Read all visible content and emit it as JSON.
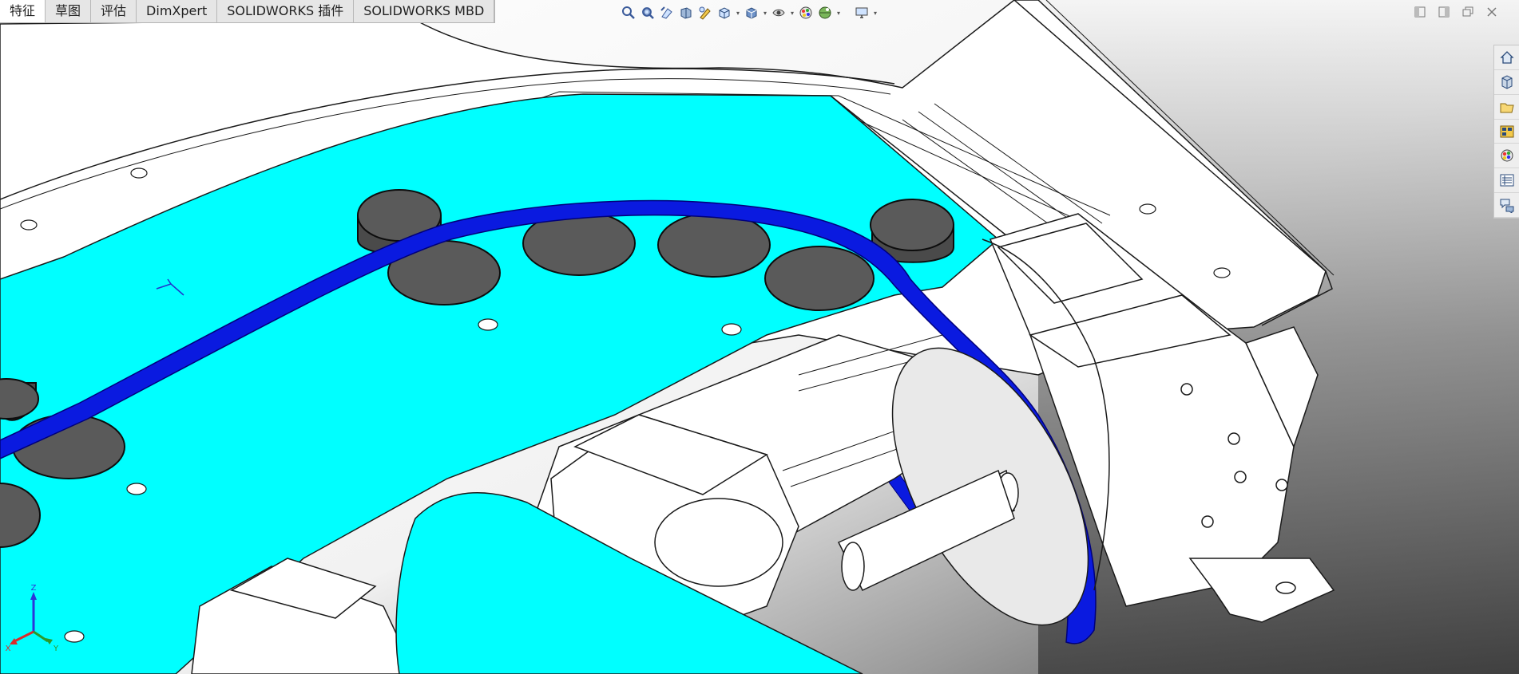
{
  "tabs": [
    {
      "label": "特征",
      "active": true
    },
    {
      "label": "草图",
      "active": false
    },
    {
      "label": "评估",
      "active": false
    },
    {
      "label": "DimXpert",
      "active": false
    },
    {
      "label": "SOLIDWORKS 插件",
      "active": false
    },
    {
      "label": "SOLIDWORKS MBD",
      "active": false
    }
  ],
  "heads_up_toolbar": [
    "zoom-to-fit-icon",
    "zoom-to-area-icon",
    "previous-view-icon",
    "section-view-icon",
    "dynamic-annotation-view-icon",
    "view-orientation-icon",
    "display-style-icon",
    "hide-show-items-icon",
    "edit-appearance-icon",
    "apply-scene-icon",
    "view-settings-icon"
  ],
  "window_controls": [
    "tile-left-icon",
    "tile-right-icon",
    "restore-icon",
    "close-icon"
  ],
  "task_pane": [
    "solidworks-resources-icon",
    "design-library-icon",
    "file-explorer-icon",
    "view-palette-icon",
    "appearances-scenes-icon",
    "custom-properties-icon",
    "forum-icon"
  ],
  "triad": {
    "x": "X",
    "y": "Y",
    "z": "Z"
  },
  "colors": {
    "plate": "#00ffff",
    "belt": "#0a1ae0",
    "disc": "#5a5a5a",
    "frame": "#ffffff",
    "edge": "#1a1a1a"
  }
}
